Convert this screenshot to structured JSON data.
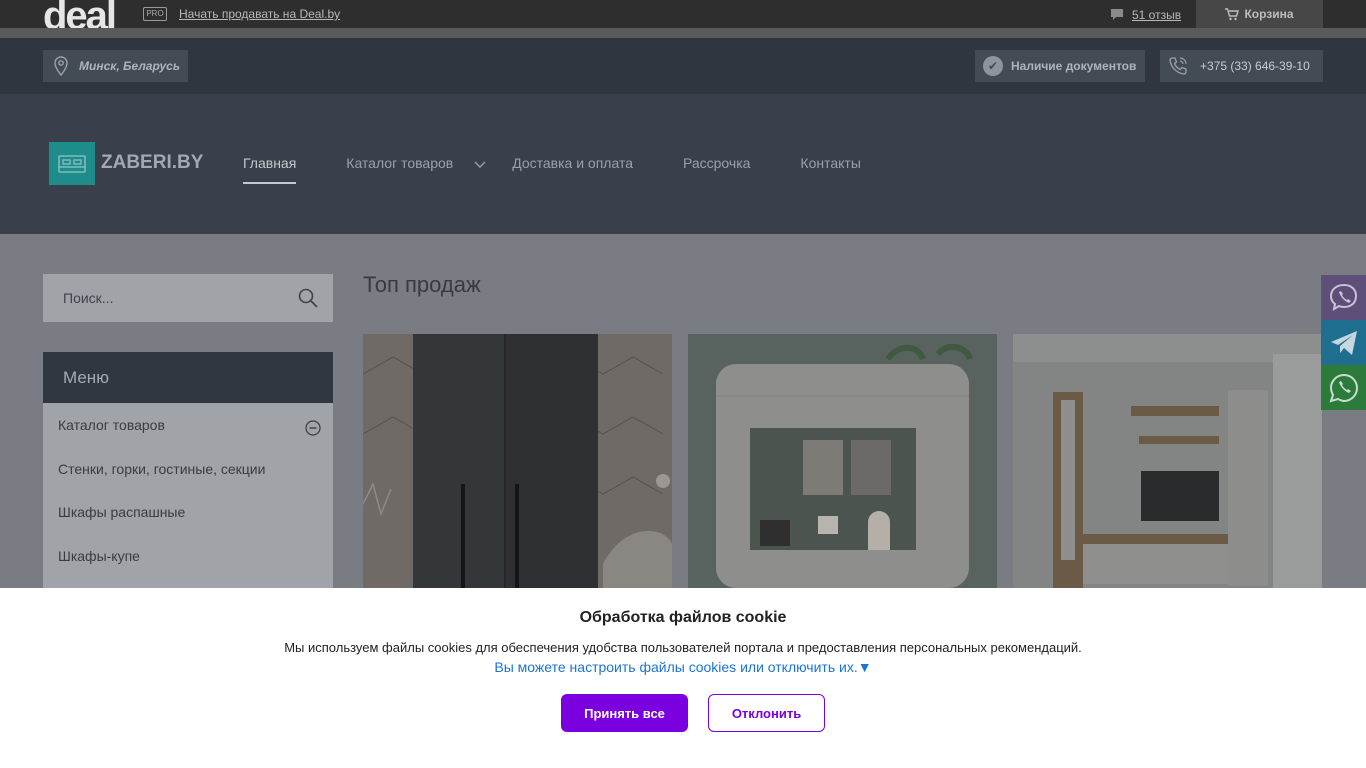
{
  "dealbar": {
    "logo": "deal",
    "pro_badge": "PRO",
    "sell_link": "Начать продавать на Deal.by",
    "reviews": "51 отзыв",
    "cart": "Корзина"
  },
  "infobar": {
    "city": "Минск, Беларусь",
    "documents": "Наличие документов",
    "phone": "+375 (33) 646-39-10"
  },
  "header": {
    "logo_text": "ZABERI.BY",
    "nav": [
      "Главная",
      "Каталог товаров",
      "Доставка и оплата",
      "Рассрочка",
      "Контакты"
    ],
    "active_nav": "Главная"
  },
  "sidebar": {
    "search_placeholder": "Поиск...",
    "menu_title": "Меню",
    "menu_items": [
      "Каталог товаров",
      "Стенки, горки, гостиные, секции",
      "Шкафы распашные",
      "Шкафы-купе"
    ]
  },
  "main": {
    "section_title": "Топ продаж"
  },
  "messengers": [
    "viber-icon",
    "telegram-icon",
    "whatsapp-icon"
  ],
  "cookie": {
    "title": "Обработка файлов cookie",
    "text": "Мы используем файлы cookies для обеспечения удобства пользователей портала и предоставления персональных рекомендаций.",
    "link": "Вы можете настроить файлы cookies или отключить их.▼",
    "accept": "Принять все",
    "decline": "Отклонить"
  },
  "colors": {
    "accent_purple": "#7b00e0",
    "link_blue": "#1a73d8",
    "logo_teal": "#1f8c8c"
  }
}
